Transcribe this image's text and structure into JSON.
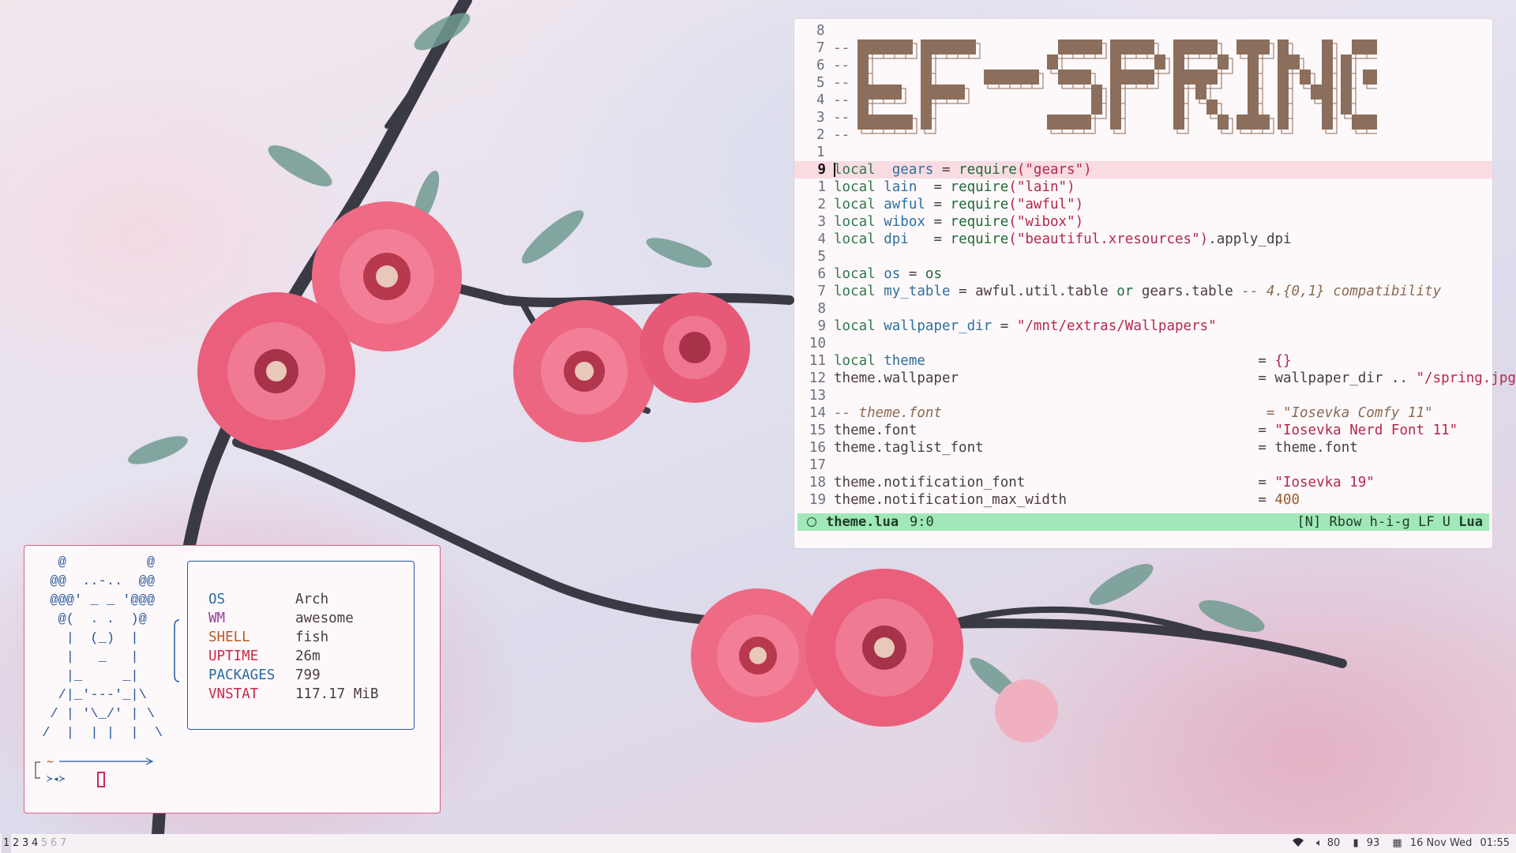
{
  "editor": {
    "banner_lines": [
      "8",
      "7 --",
      "6 --",
      "5 --",
      "4 --",
      "3 --",
      "2 --",
      "1"
    ],
    "banner_text": "EF-SPRING",
    "lines": [
      {
        "n": "9",
        "cur": true,
        "parts": [
          [
            "kw",
            "local"
          ],
          [
            "",
            "  "
          ],
          [
            "var",
            "gears"
          ],
          [
            "",
            " = "
          ],
          [
            "fn",
            "require"
          ],
          [
            "pun",
            "("
          ],
          [
            "str",
            "\"gears\""
          ],
          [
            "pun",
            ")"
          ]
        ]
      },
      {
        "n": "1",
        "parts": [
          [
            "kw",
            "local"
          ],
          [
            "",
            " "
          ],
          [
            "var",
            "lain"
          ],
          [
            "",
            "  = "
          ],
          [
            "fn",
            "require"
          ],
          [
            "pun",
            "("
          ],
          [
            "str",
            "\"lain\""
          ],
          [
            "pun",
            ")"
          ]
        ]
      },
      {
        "n": "2",
        "parts": [
          [
            "kw",
            "local"
          ],
          [
            "",
            " "
          ],
          [
            "var",
            "awful"
          ],
          [
            "",
            " = "
          ],
          [
            "fn",
            "require"
          ],
          [
            "pun",
            "("
          ],
          [
            "str",
            "\"awful\""
          ],
          [
            "pun",
            ")"
          ]
        ]
      },
      {
        "n": "3",
        "parts": [
          [
            "kw",
            "local"
          ],
          [
            "",
            " "
          ],
          [
            "var",
            "wibox"
          ],
          [
            "",
            " = "
          ],
          [
            "fn",
            "require"
          ],
          [
            "pun",
            "("
          ],
          [
            "str",
            "\"wibox\""
          ],
          [
            "pun",
            ")"
          ]
        ]
      },
      {
        "n": "4",
        "parts": [
          [
            "kw",
            "local"
          ],
          [
            "",
            " "
          ],
          [
            "var",
            "dpi"
          ],
          [
            "",
            "   = "
          ],
          [
            "fn",
            "require"
          ],
          [
            "pun",
            "("
          ],
          [
            "str",
            "\"beautiful.xresources\""
          ],
          [
            "pun",
            ")"
          ],
          [
            "",
            ".apply_dpi"
          ]
        ]
      },
      {
        "n": "5",
        "parts": []
      },
      {
        "n": "6",
        "parts": [
          [
            "kw",
            "local"
          ],
          [
            "",
            " "
          ],
          [
            "var",
            "os"
          ],
          [
            "",
            " = "
          ],
          [
            "fn",
            "os"
          ]
        ]
      },
      {
        "n": "7",
        "parts": [
          [
            "kw",
            "local"
          ],
          [
            "",
            " "
          ],
          [
            "var",
            "my_table"
          ],
          [
            "",
            " = awful.util.table "
          ],
          [
            "fn",
            "or"
          ],
          [
            "",
            " gears.table "
          ],
          [
            "cmt",
            "-- 4.{0,1} compatibility"
          ]
        ]
      },
      {
        "n": "8",
        "parts": []
      },
      {
        "n": "9",
        "parts": [
          [
            "kw",
            "local"
          ],
          [
            "",
            " "
          ],
          [
            "var",
            "wallpaper_dir"
          ],
          [
            "",
            " = "
          ],
          [
            "str",
            "\"/mnt/extras/Wallpapers\""
          ]
        ]
      },
      {
        "n": "10",
        "parts": []
      },
      {
        "n": "11",
        "parts": [
          [
            "kw",
            "local"
          ],
          [
            "",
            " "
          ],
          [
            "var",
            "theme"
          ],
          [
            "",
            "                                        = "
          ],
          [
            "pun",
            "{}"
          ]
        ]
      },
      {
        "n": "12",
        "parts": [
          [
            "",
            "theme.wallpaper                                    = wallpaper_dir .. "
          ],
          [
            "str",
            "\"/spring.jpg\""
          ]
        ]
      },
      {
        "n": "13",
        "parts": []
      },
      {
        "n": "14",
        "parts": [
          [
            "cmt",
            "-- theme.font                                       = \"Iosevka Comfy 11\""
          ]
        ]
      },
      {
        "n": "15",
        "parts": [
          [
            "",
            "theme.font                                         = "
          ],
          [
            "str",
            "\"Iosevka Nerd Font 11\""
          ]
        ]
      },
      {
        "n": "16",
        "parts": [
          [
            "",
            "theme.taglist_font                                 = theme.font"
          ]
        ]
      },
      {
        "n": "17",
        "parts": []
      },
      {
        "n": "18",
        "parts": [
          [
            "",
            "theme.notification_font                            = "
          ],
          [
            "str",
            "\"Iosevka 19\""
          ]
        ]
      },
      {
        "n": "19",
        "parts": [
          [
            "",
            "theme.notification_max_width                       = "
          ],
          [
            "num",
            "400"
          ]
        ]
      }
    ],
    "status": {
      "file": "theme.lua",
      "pos": "9:0",
      "right": "[N] Rbow h-i-g LF U",
      "ft": "Lua"
    }
  },
  "terminal": {
    "ascii": "   @          @\n  @@  ..-..  @@\n  @@@' _ _ '@@@\n   @(  . .  )@\n    |  (_)  |\n    |   _   |\n    |_     _|\n   /|_'---'_|\\\n  / | '\\_/' | \\\n /  |  | |  |  \\",
    "info": [
      {
        "key": "OS",
        "value": "Arch",
        "color": "#2a6aa0"
      },
      {
        "key": "WM",
        "value": "awesome",
        "color": "#9a3aa0"
      },
      {
        "key": "SHELL",
        "value": "fish",
        "color": "#b85a20"
      },
      {
        "key": "UPTIME",
        "value": "26m",
        "color": "#c82a4a"
      },
      {
        "key": "PACKAGES",
        "value": "799",
        "color": "#2a6aa0"
      },
      {
        "key": "VNSTAT",
        "value": "117.17 MiB",
        "color": "#c82a4a"
      }
    ],
    "prompt_dir": "~",
    "prompt_symbol": "≻◂≻"
  },
  "bar": {
    "tags": [
      "1",
      "2",
      "3",
      "4",
      "5",
      "6",
      "7"
    ],
    "active_tag": "1",
    "volume": "80",
    "battery": "93",
    "date": "16 Nov Wed",
    "time": "01:55"
  },
  "colors": {
    "accent": "#d8608a",
    "status_bg": "#a0e8b8",
    "cursor_line": "#f8dce2"
  }
}
